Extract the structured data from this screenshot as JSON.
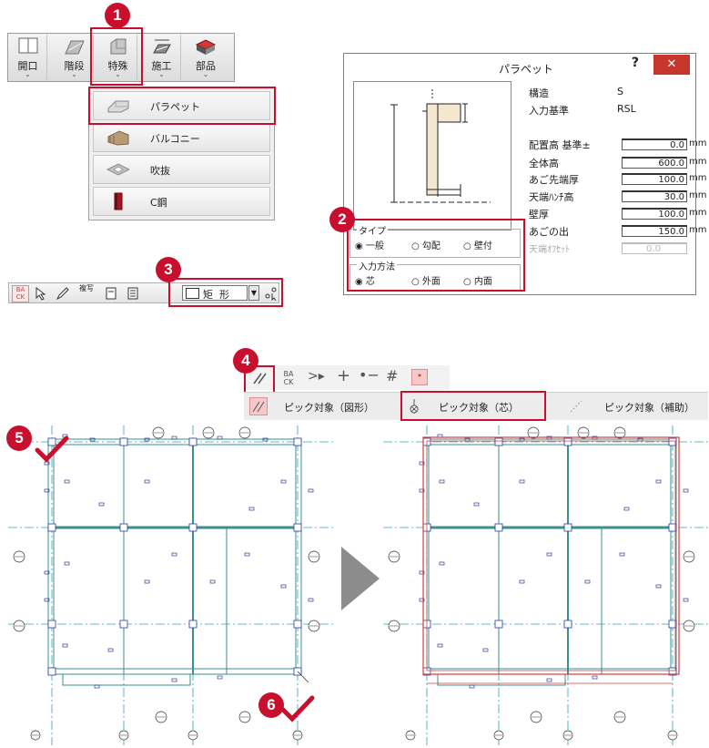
{
  "toolbar1": {
    "buttons": [
      {
        "label": "開口",
        "arrow": "⌄"
      },
      {
        "label": "階段",
        "arrow": "⌄"
      },
      {
        "label": "特殊",
        "arrow": "⌄"
      },
      {
        "label": "施工",
        "arrow": "⌄"
      },
      {
        "label": "部品",
        "arrow": "⌄"
      }
    ]
  },
  "special_menu": {
    "items": [
      "パラペット",
      "バルコニー",
      "吹抜",
      "C鋼"
    ]
  },
  "steps": [
    "1",
    "2",
    "3",
    "4",
    "5",
    "6"
  ],
  "dialog": {
    "title": "パラペット",
    "help": "?",
    "close": "✕",
    "info": [
      {
        "label": "構造",
        "value": "S"
      },
      {
        "label": "入力基準",
        "value": "RSL"
      }
    ],
    "fields": [
      {
        "label": "配置高 基準±",
        "value": "0.0",
        "unit": "mm",
        "enabled": true
      },
      {
        "label": "全体高",
        "value": "600.0",
        "unit": "mm",
        "enabled": true
      },
      {
        "label": "あご先端厚",
        "value": "100.0",
        "unit": "mm",
        "enabled": true
      },
      {
        "label": "天端ﾊﾝﾁ高",
        "value": "30.0",
        "unit": "mm",
        "enabled": true
      },
      {
        "label": "壁厚",
        "value": "100.0",
        "unit": "mm",
        "enabled": true
      },
      {
        "label": "あごの出",
        "value": "150.0",
        "unit": "mm",
        "enabled": true
      },
      {
        "label": "天端ｵﾌｾｯﾄ",
        "value": "0.0",
        "unit": "",
        "enabled": false
      }
    ],
    "type_group": {
      "label": "タイプ",
      "options": [
        {
          "label": "一般",
          "selected": true
        },
        {
          "label": "勾配",
          "selected": false
        },
        {
          "label": "壁付",
          "selected": false
        }
      ]
    },
    "method_group": {
      "label": "入力方法",
      "options": [
        {
          "label": "芯",
          "selected": true
        },
        {
          "label": "外面",
          "selected": false
        },
        {
          "label": "内面",
          "selected": false
        }
      ]
    }
  },
  "toolbar3": {
    "batch_label": "BA\nCK",
    "multi_label": "複写",
    "shape_select": "矩  形"
  },
  "toolbar4": {
    "batch_label": "BA\nCK"
  },
  "pick_options": [
    {
      "label": "ピック対象（図形）",
      "selected": false
    },
    {
      "label": "ピック対象（芯）",
      "selected": true
    },
    {
      "label": "ピック対象（補助）",
      "selected": false
    }
  ],
  "colors": {
    "accent_red": "#c8102e",
    "wall_teal": "#3a8f8f",
    "grid_cyan": "#2aa5b8",
    "column_blue": "#2a3aa0",
    "parapet_red": "#d04040"
  },
  "arrow_icon": "play-triangle-icon"
}
